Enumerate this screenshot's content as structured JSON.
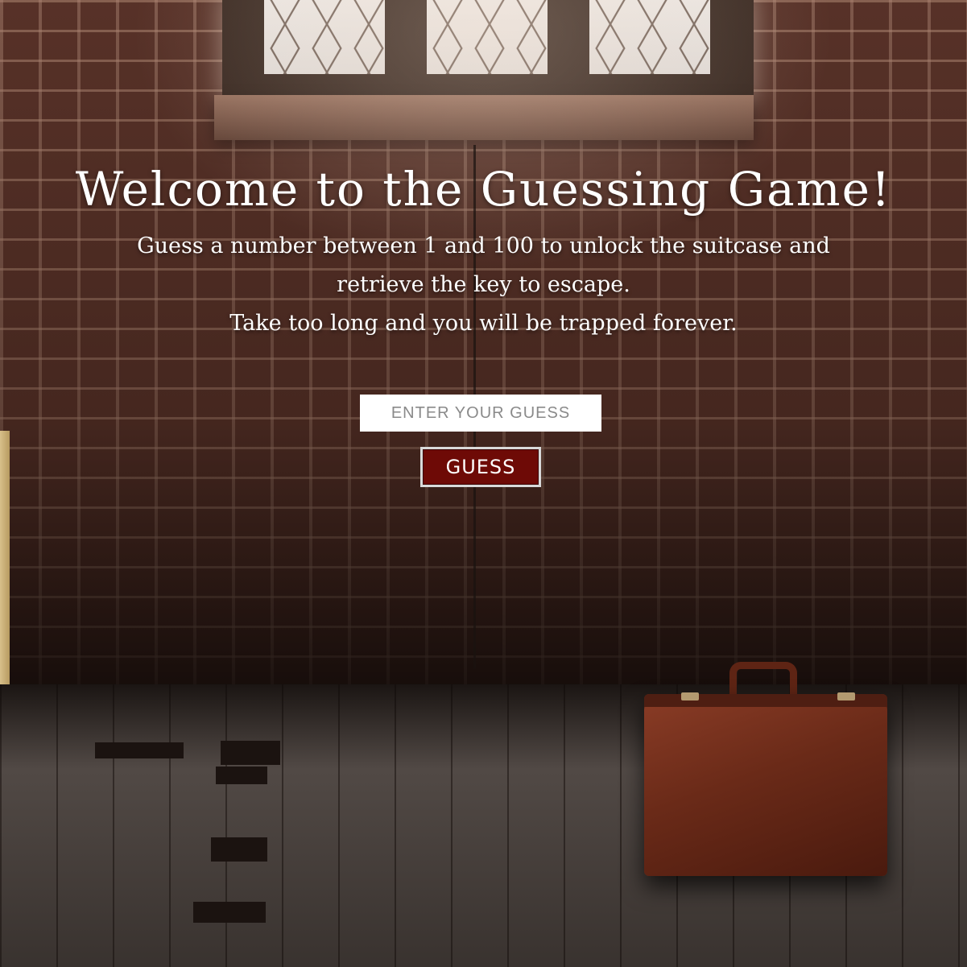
{
  "header": {
    "title": "Welcome to the Guessing Game!"
  },
  "intro": {
    "line1": "Guess a number between 1 and 100 to unlock the suitcase and retrieve the key to escape.",
    "line2": "Take too long and you will be trapped forever."
  },
  "form": {
    "guess_placeholder": "ENTER YOUR GUESS",
    "guess_value": "",
    "guess_button_label": "GUESS"
  },
  "colors": {
    "button_background": "#6e0a06",
    "title_text": "#ffffff"
  },
  "icons": {
    "background": "brick-room-with-suitcase-image",
    "suitcase": "suitcase-icon"
  }
}
